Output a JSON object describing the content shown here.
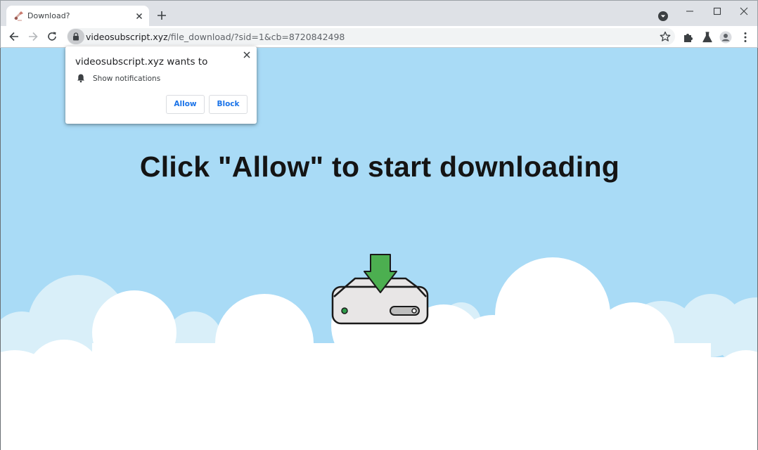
{
  "browser": {
    "tab": {
      "title": "Download?"
    },
    "address": {
      "domain": "videosubscript.xyz",
      "path": "/file_download/?sid=1&cb=8720842498"
    }
  },
  "permission_popup": {
    "title": "videosubscript.xyz wants to",
    "permission": "Show notifications",
    "allow_label": "Allow",
    "block_label": "Block"
  },
  "page": {
    "headline": "Click \"Allow\" to start downloading",
    "colors": {
      "sky": "#a9dbf6",
      "arrow": "#4caf50",
      "drive": "#e8e6e6"
    }
  },
  "icons": {
    "tab": "tab-favicon",
    "new_tab": "plus-icon",
    "tab_search": "chevron-down-circle-icon",
    "window": [
      "minimize-icon",
      "maximize-icon",
      "close-icon"
    ],
    "nav": [
      "back-arrow-icon",
      "forward-arrow-icon",
      "reload-icon"
    ],
    "omnibox": [
      "lock-icon",
      "star-icon"
    ],
    "toolbar": [
      "extensions-puzzle-icon",
      "labs-flask-icon",
      "profile-avatar-icon",
      "more-menu-icon"
    ]
  }
}
